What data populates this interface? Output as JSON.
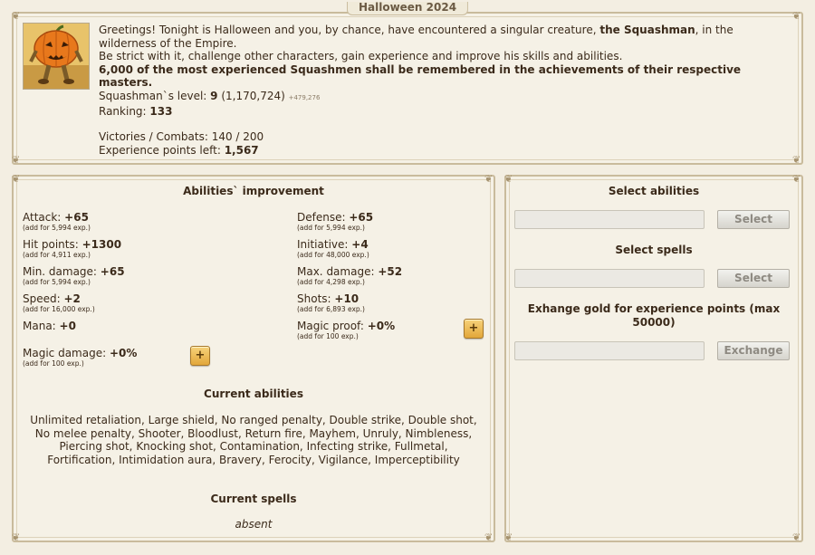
{
  "event": {
    "title": "Halloween 2024"
  },
  "intro": {
    "line1_prefix": "Greetings! Tonight is Halloween and you, by chance, have encountered a singular creature, ",
    "line1_bold": "the Squashman",
    "line1_suffix": ", in the wilderness of the Empire.",
    "line2": "Be strict with it, challenge other characters, gain experience and improve his skills and abilities.",
    "line3": "6,000 of the most experienced Squashmen shall be remembered in the achievements of their respective masters."
  },
  "stats": {
    "level_label": "Squashman`s level: ",
    "level_value": "9",
    "level_exp": " (1,170,724) ",
    "level_gain": "+479,276",
    "ranking_label": "Ranking: ",
    "ranking_value": "133",
    "victories_label": "Victories / Combats: 140 / 200",
    "exp_left_label": "Experience points left: ",
    "exp_left_value": "1,567"
  },
  "abilities_panel": {
    "heading": "Abilities` improvement",
    "items": [
      {
        "label": "Attack: ",
        "value": "+65",
        "cost": "(add for 5,994 exp.)"
      },
      {
        "label": "Defense: ",
        "value": "+65",
        "cost": "(add for 5,994 exp.)"
      },
      {
        "label": "Hit points: ",
        "value": "+1300",
        "cost": "(add for 4,911 exp.)"
      },
      {
        "label": "Initiative: ",
        "value": "+4",
        "cost": "(add for 48,000 exp.)"
      },
      {
        "label": "Min. damage: ",
        "value": "+65",
        "cost": "(add for 5,994 exp.)"
      },
      {
        "label": "Max. damage: ",
        "value": "+52",
        "cost": "(add for 4,298 exp.)"
      },
      {
        "label": "Speed: ",
        "value": "+2",
        "cost": "(add for 16,000 exp.)"
      },
      {
        "label": "Shots: ",
        "value": "+10",
        "cost": "(add for 6,893 exp.)"
      },
      {
        "label": "Mana: ",
        "value": "+0",
        "cost": ""
      },
      {
        "label": "Magic proof: ",
        "value": "+0%",
        "cost": "(add for 100 exp.)"
      },
      {
        "label": "Magic damage: ",
        "value": "+0%",
        "cost": "(add for 100 exp.)"
      }
    ],
    "plus_label": "+",
    "current_abilities_heading": "Current abilities",
    "current_abilities_text": "Unlimited retaliation, Large shield, No ranged penalty, Double strike, Double shot, No melee penalty, Shooter, Bloodlust, Return fire, Mayhem, Unruly, Nimbleness, Piercing shot, Knocking shot, Contamination, Infecting strike, Fullmetal, Fortification, Intimidation aura, Bravery, Ferocity, Vigilance, Imperceptibility",
    "current_spells_heading": "Current spells",
    "current_spells_text": "absent"
  },
  "right_panel": {
    "select_abilities_heading": "Select abilities",
    "select_abilities_button": "Select",
    "select_spells_heading": "Select spells",
    "select_spells_button": "Select",
    "exchange_heading": "Exhange gold for experience points (max 50000)",
    "exchange_button": "Exchange"
  },
  "colors": {
    "panel_bg": "#f5f1e6",
    "border": "#c9bb9c",
    "plus_button": "#eeb84d"
  }
}
